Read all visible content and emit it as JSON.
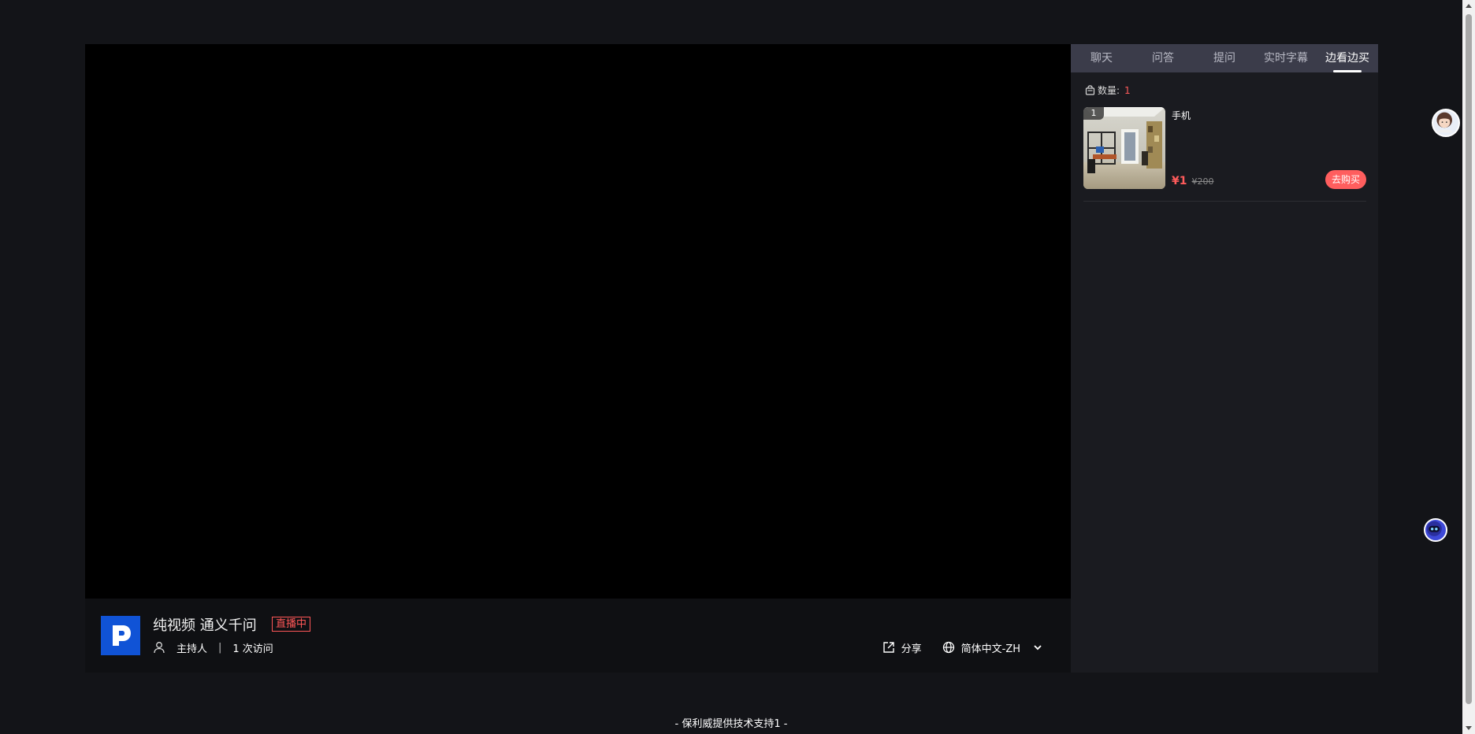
{
  "room": {
    "title": "纯视频 通义千问",
    "live_badge": "直播中",
    "host_label": "主持人",
    "divider": "|",
    "visits": "1 次访问"
  },
  "actions": {
    "share_label": "分享",
    "language_label": "简体中文-ZH"
  },
  "side_panel": {
    "tabs": [
      {
        "label": "聊天",
        "active": false
      },
      {
        "label": "问答",
        "active": false
      },
      {
        "label": "提问",
        "active": false
      },
      {
        "label": "实时字幕",
        "active": false
      },
      {
        "label": "边看边买",
        "active": true
      }
    ],
    "count_label": "数量:",
    "count_value": "1",
    "products": [
      {
        "rank": "1",
        "name": "手机",
        "price": "¥1",
        "original_price": "¥200",
        "buy_label": "去购买"
      }
    ]
  },
  "footer": {
    "text": "- 保利威提供技术支持1 -"
  },
  "colors": {
    "accent_red": "#ff5e5e",
    "logo_blue": "#1053d6",
    "tab_bar": "#3b3c4a",
    "panel_bg": "#1a1b20"
  }
}
